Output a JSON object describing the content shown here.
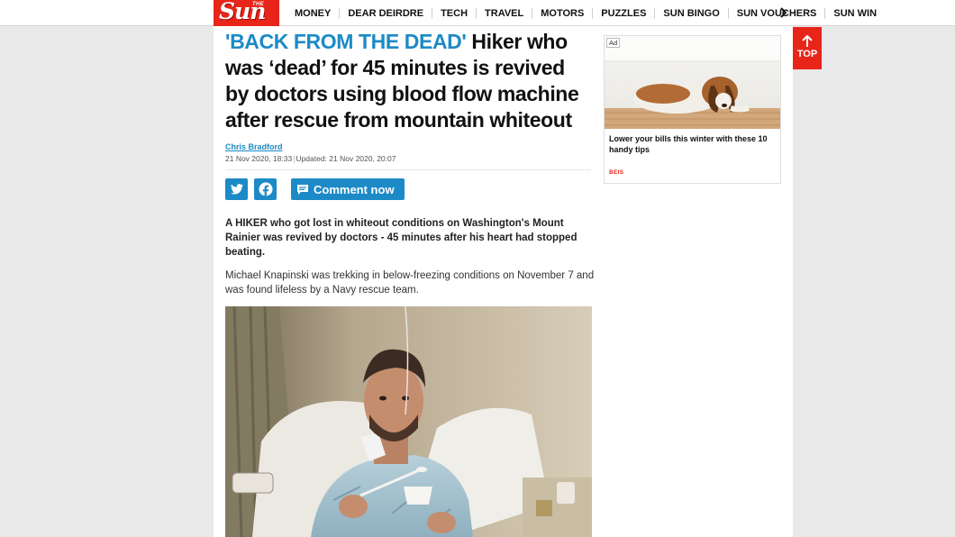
{
  "header": {
    "logo_the": "THE",
    "logo_sun": "Sun",
    "nav": [
      "MONEY",
      "DEAR DEIRDRE",
      "TECH",
      "TRAVEL",
      "MOTORS",
      "PUZZLES",
      "SUN BINGO",
      "SUN VOUCHERS",
      "SUN WIN"
    ],
    "more_icon": "chevron-right-icon"
  },
  "article": {
    "kicker": "'BACK FROM THE DEAD'",
    "headline": "Hiker who was ‘dead’ for 45 minutes is revived by doctors using blood flow machine after rescue from mountain whiteout",
    "author": "Chris Bradford",
    "published": "21 Nov 2020, 18:33",
    "updated": "Updated: 21 Nov 2020, 20:07",
    "share_icons": [
      "twitter-icon",
      "facebook-icon"
    ],
    "comment_label": "Comment now",
    "standfirst": "A HIKER who got lost in whiteout conditions on Washington's Mount Rainier was revived by doctors - 45 minutes after his heart had stopped beating.",
    "paragraph": "Michael Knapinski was trekking in below-freezing conditions on November 7 and was found lifeless by a Navy rescue team."
  },
  "ad": {
    "badge": "Ad",
    "headline": "Lower your bills this winter with these 10 handy tips",
    "source": "BEIS"
  },
  "top_button": {
    "label": "TOP"
  },
  "colors": {
    "brand_red": "#e8251a",
    "accent_blue": "#1c8ac6"
  }
}
